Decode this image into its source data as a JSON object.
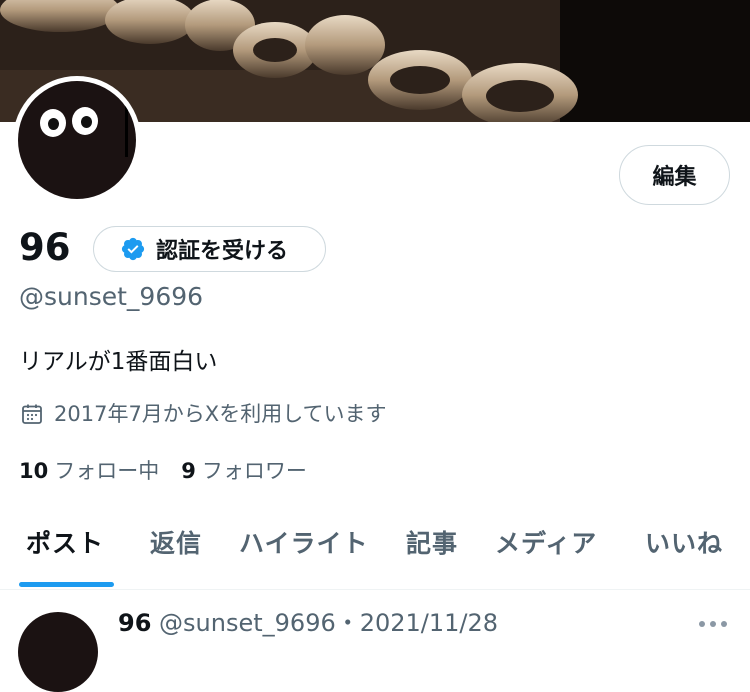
{
  "profile": {
    "display_name": "96",
    "handle": "@sunset_9696",
    "bio": "リアルが1番面白い",
    "joined": "2017年7月からXを利用しています",
    "following_count": "10",
    "following_label": "フォロー中",
    "followers_count": "9",
    "followers_label": "フォロワー"
  },
  "buttons": {
    "edit_label": "編集",
    "verify_label": "認証を受ける"
  },
  "tabs": [
    {
      "label": "ポスト",
      "active": true
    },
    {
      "label": "返信",
      "active": false
    },
    {
      "label": "ハイライト",
      "active": false
    },
    {
      "label": "記事",
      "active": false
    },
    {
      "label": "メディア",
      "active": false
    },
    {
      "label": "いいね",
      "active": false
    }
  ],
  "post": {
    "author": "96",
    "meta": "@sunset_9696・2021/11/28"
  },
  "icons": {
    "verified": "verified-badge-icon",
    "calendar": "calendar-icon",
    "more": "more-icon"
  },
  "colors": {
    "accent": "#1d9bf0",
    "text_primary": "#0f1419",
    "text_secondary": "#536471",
    "border": "#cfd9de"
  }
}
